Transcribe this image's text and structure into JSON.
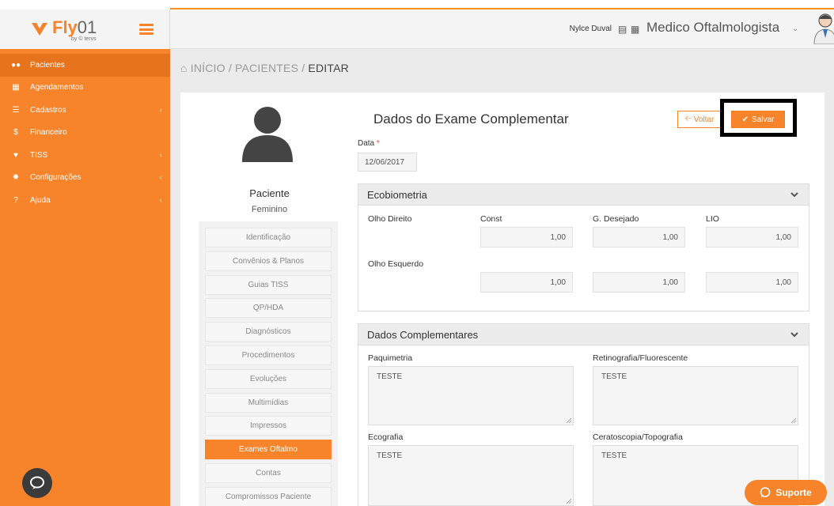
{
  "brand": {
    "logo_text": "Fly",
    "logo_num": "01",
    "logo_sub": "by © tervs"
  },
  "sidebar": {
    "items": [
      {
        "label": "Pacientes",
        "icon": "users-icon",
        "caret": ""
      },
      {
        "label": "Agendamentos",
        "icon": "calendar-icon",
        "caret": ""
      },
      {
        "label": "Cadastros",
        "icon": "list-icon",
        "caret": "‹"
      },
      {
        "label": "Financeiro",
        "icon": "dollar-icon",
        "caret": ""
      },
      {
        "label": "TISS",
        "icon": "heartbeat-icon",
        "caret": "‹"
      },
      {
        "label": "Configurações",
        "icon": "gear-icon",
        "caret": "‹"
      },
      {
        "label": "Ajuda",
        "icon": "question-icon",
        "caret": "‹"
      }
    ]
  },
  "header": {
    "user_name": "Nylce Duval",
    "role": "Medico Oftalmologista"
  },
  "breadcrumb": {
    "home": "INÍCIO",
    "section": "PACIENTES",
    "current": "EDITAR",
    "sep": "/"
  },
  "patient": {
    "name": "Paciente",
    "sex": "Feminino"
  },
  "patient_menu": [
    "Identificação",
    "Convênios & Planos",
    "Guias TISS",
    "QP/HDA",
    "Diagnósticos",
    "Procedimentos",
    "Evoluções",
    "Multimídias",
    "Impressos",
    "Exames Oftalmo",
    "Contas",
    "Compromissos Paciente"
  ],
  "patient_menu_active": "Exames Oftalmo",
  "form": {
    "title": "Dados do Exame Complementar",
    "voltar_label": "Voltar",
    "salvar_label": "Salvar",
    "data_label": "Data",
    "data_required": "*",
    "data_value": "12/06/2017"
  },
  "ecobiometria": {
    "title": "Ecobiometria",
    "col_const": "Const",
    "col_desejado": "G. Desejado",
    "col_lio": "LIO",
    "olho_direito": {
      "label": "Olho Direito",
      "const": "1,00",
      "desejado": "1,00",
      "lio": "1,00"
    },
    "olho_esquerdo": {
      "label": "Olho Esquerdo",
      "const": "1,00",
      "desejado": "1,00",
      "lio": "1,00"
    }
  },
  "complementares": {
    "title": "Dados Complementares",
    "paquimetria": {
      "label": "Paquimetria",
      "value": "TESTE"
    },
    "retinografia": {
      "label": "Retinografia/Fluorescente",
      "value": "TESTE"
    },
    "ecografia": {
      "label": "Ecografia",
      "value": "TESTE"
    },
    "ceratoscopia": {
      "label": "Ceratoscopia/Topografia",
      "value": "TESTE"
    }
  },
  "support": {
    "label": "Suporte"
  },
  "colors": {
    "accent": "#f7842a",
    "sidebar_active": "#e8731d",
    "highlight": "#000000"
  }
}
